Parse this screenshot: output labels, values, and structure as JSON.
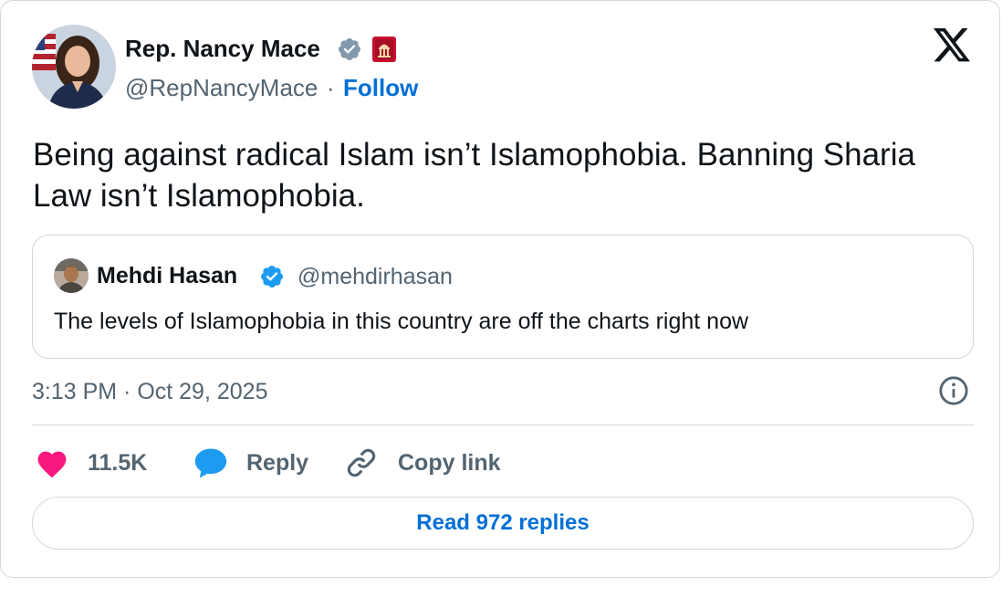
{
  "post": {
    "author": {
      "name": "Rep. Nancy Mace",
      "handle": "@RepNancyMace",
      "follow_label": "Follow",
      "separator": "·"
    },
    "text": "Being against radical Islam isn’t Islamophobia. Banning Sharia Law isn’t Islamophobia.",
    "quoted": {
      "name": "Mehdi Hasan",
      "handle": "@mehdirhasan",
      "text": "The levels of Islamophobia in this country are off the charts right now"
    },
    "timestamp": "3:13 PM · Oct 29, 2025"
  },
  "actions": {
    "likes": "11.5K",
    "reply_label": "Reply",
    "copy_link_label": "Copy link"
  },
  "read_replies_label": "Read 972 replies",
  "icons": {
    "logo": "x-logo-icon",
    "verified_gov": "gray-verified-icon",
    "affiliate": "house-seal-icon",
    "verified": "blue-verified-icon",
    "info": "info-icon",
    "heart": "heart-icon",
    "reply": "speech-bubble-icon",
    "link": "chain-link-icon"
  },
  "colors": {
    "accent": "#006fd6",
    "heart": "#f91880",
    "reply_bubble": "#1d9bf0",
    "secondary_text": "#536471",
    "border": "#cfd9de",
    "verified_gray": "#829aab",
    "verified_blue": "#1d9bf0"
  }
}
